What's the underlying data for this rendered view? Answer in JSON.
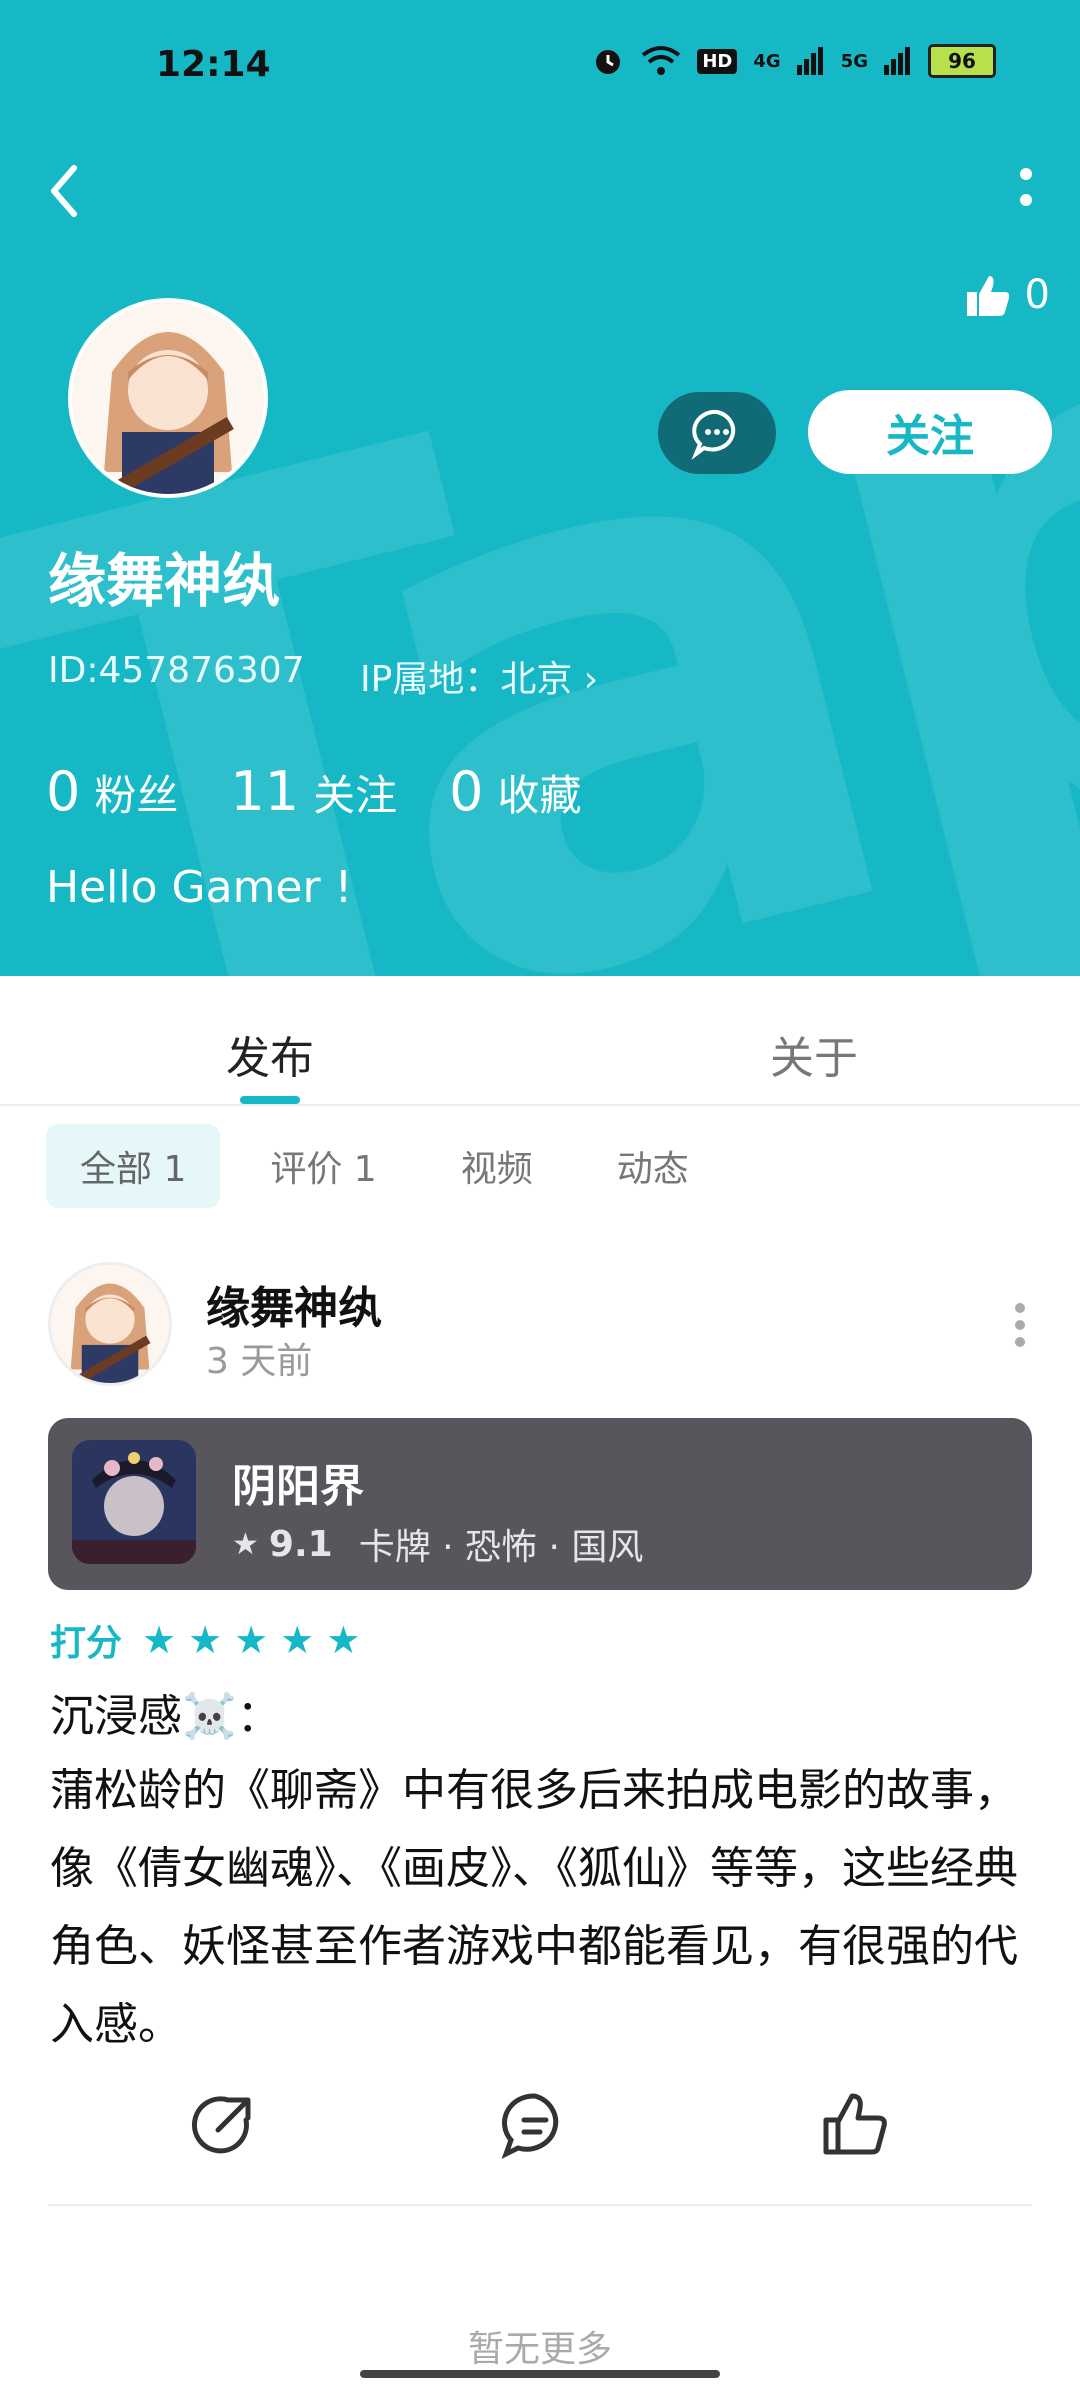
{
  "status": {
    "time": "12:14",
    "signal_a": "4G",
    "signal_b": "5G",
    "battery": "96"
  },
  "header": {
    "likes_count": "0",
    "follow_label": "关注",
    "username": "缘舞神纨",
    "id_text": "ID:457876307",
    "ip_text": "IP属地：北京 ›",
    "stats": {
      "followers_num": "0",
      "followers_label": "粉丝",
      "following_num": "11",
      "following_label": "关注",
      "favorites_num": "0",
      "favorites_label": "收藏"
    },
    "bio": "Hello Gamer !"
  },
  "tabs": {
    "publish": "发布",
    "about": "关于"
  },
  "filters": {
    "all": "全部 1",
    "reviews": "评价 1",
    "videos": "视频",
    "posts": "动态"
  },
  "post": {
    "author": "缘舞神纨",
    "time": "3 天前",
    "game": {
      "name": "阴阳界",
      "rating": "9.1",
      "tags": "卡牌 · 恐怖 · 国风"
    },
    "rating_label": "打分",
    "title": "沉浸感☠️：",
    "body": "蒲松龄的《聊斋》中有很多后来拍成电影的故事，像《倩女幽魂》、《画皮》、《狐仙》等等，这些经典角色、妖怪甚至作者游戏中都能看见，有很强的代入感。"
  },
  "footer": {
    "text": "暂无更多"
  },
  "colors": {
    "accent": "#16b8c6",
    "message_button": "#116b76",
    "game_card": "#58565c"
  }
}
